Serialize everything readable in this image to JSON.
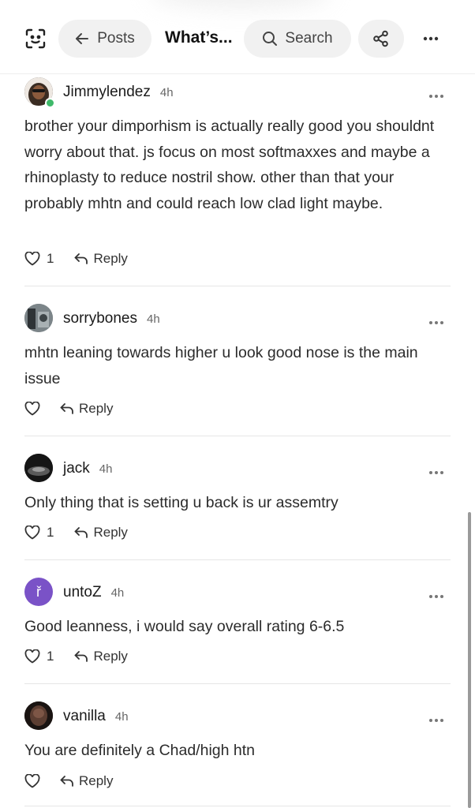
{
  "header": {
    "back_label": "Posts",
    "title": "What’s...",
    "search_label": "Search",
    "icons": {
      "scan": "scan-face-icon",
      "back": "arrow-left-icon",
      "search": "search-icon",
      "share": "share-icon",
      "more": "more-horizontal-icon"
    }
  },
  "comments": [
    {
      "username": "Jimmylendez",
      "time": "4h",
      "text": "brother your dimporhism is actually really good you shouldnt worry about that. js focus on most softmaxxes and maybe a rhinoplasty to reduce nostril show. other than that your probably mhtn and could reach low clad light maybe.",
      "likes": "1",
      "reply_label": "Reply",
      "online": true
    },
    {
      "username": "sorrybones",
      "time": "4h",
      "text": "mhtn leaning towards higher u look good nose is the main issue",
      "likes": "",
      "reply_label": "Reply"
    },
    {
      "username": "jack",
      "time": "4h",
      "text": "Only thing that is setting u back is ur assemtry",
      "likes": "1",
      "reply_label": "Reply"
    },
    {
      "username": "untoZ",
      "time": "4h",
      "text": "Good leanness, i would say overall rating 6-6.5",
      "likes": "1",
      "reply_label": "Reply",
      "avatar_letter": "ř",
      "avatar_color": "#7a52c7"
    },
    {
      "username": "vanilla",
      "time": "4h",
      "text": "You are definitely a Chad/high htn",
      "likes": "",
      "reply_label": "Reply"
    }
  ]
}
